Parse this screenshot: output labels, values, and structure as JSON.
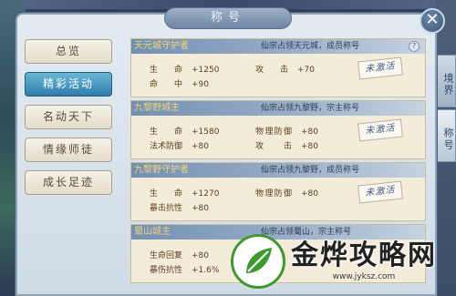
{
  "window": {
    "title": "称号"
  },
  "side_tabs": [
    "境界",
    "称号"
  ],
  "nav": [
    {
      "label": "总览",
      "active": false
    },
    {
      "label": "精彩活动",
      "active": true
    },
    {
      "label": "名动天下",
      "active": false
    },
    {
      "label": "情缘师徒",
      "active": false
    },
    {
      "label": "成长足迹",
      "active": false
    }
  ],
  "cards": [
    {
      "name": "天元城守护者",
      "desc": "仙宗占领天元城，成员称号",
      "stats": [
        {
          "label": "生命",
          "value": "+1250"
        },
        {
          "label": "攻击",
          "value": "+70"
        },
        {
          "label": "命中",
          "value": "+90"
        }
      ],
      "stamp": "未激活"
    },
    {
      "name": "九黎野城主",
      "desc": "仙宗占领九黎野，宗主称号",
      "stats": [
        {
          "label": "生命",
          "value": "+1580"
        },
        {
          "label": "物理防御",
          "value": "+80"
        },
        {
          "label": "法术防御",
          "value": "+80"
        },
        {
          "label": "攻击",
          "value": "+80"
        }
      ],
      "stamp": "未激活"
    },
    {
      "name": "九黎野守护者",
      "desc": "仙宗占领九黎野，成员称号",
      "stats": [
        {
          "label": "生命",
          "value": "+1270"
        },
        {
          "label": "物理防御",
          "value": "+80"
        },
        {
          "label": "暴击抗性",
          "value": "+80"
        }
      ],
      "stamp": "未激活"
    },
    {
      "name": "蜀山城主",
      "desc": "仙宗占领蜀山，宗主称号",
      "stats": [
        {
          "label": "生命回复",
          "value": "+80"
        },
        {
          "label": "暴伤抗性",
          "value": "+1.6%"
        }
      ]
    }
  ],
  "watermark": {
    "text": "金烨攻略网",
    "url": "www.jyksz.com"
  },
  "colors": {
    "accent": "#2f7eab",
    "card_bg": "#f3ecd9",
    "title_gold": "#f0d478"
  }
}
